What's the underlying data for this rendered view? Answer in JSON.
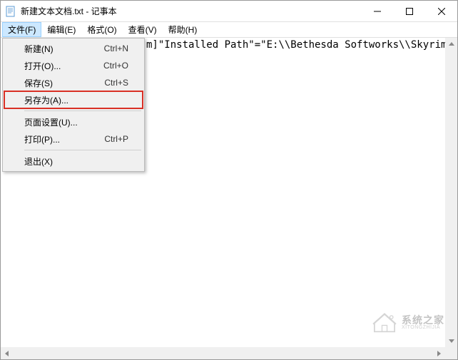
{
  "window": {
    "title": "新建文本文档.txt - 记事本"
  },
  "menubar": {
    "file": "文件(F)",
    "edit": "编辑(E)",
    "format": "格式(O)",
    "view": "查看(V)",
    "help": "帮助(H)"
  },
  "file_menu": {
    "new": {
      "label": "新建(N)",
      "shortcut": "Ctrl+N"
    },
    "open": {
      "label": "打开(O)...",
      "shortcut": "Ctrl+O"
    },
    "save": {
      "label": "保存(S)",
      "shortcut": "Ctrl+S"
    },
    "save_as": {
      "label": "另存为(A)...",
      "shortcut": ""
    },
    "page_setup": {
      "label": "页面设置(U)...",
      "shortcut": ""
    },
    "print": {
      "label": "打印(P)...",
      "shortcut": "Ctrl+P"
    },
    "exit": {
      "label": "退出(X)",
      "shortcut": ""
    }
  },
  "editor": {
    "visible_text": "m]\"Installed Path\"=\"E:\\\\Bethesda Softworks\\\\Skyrim\\\\\""
  },
  "watermark": {
    "cn": "系统之家",
    "en": "XITONGZHIJIA"
  }
}
